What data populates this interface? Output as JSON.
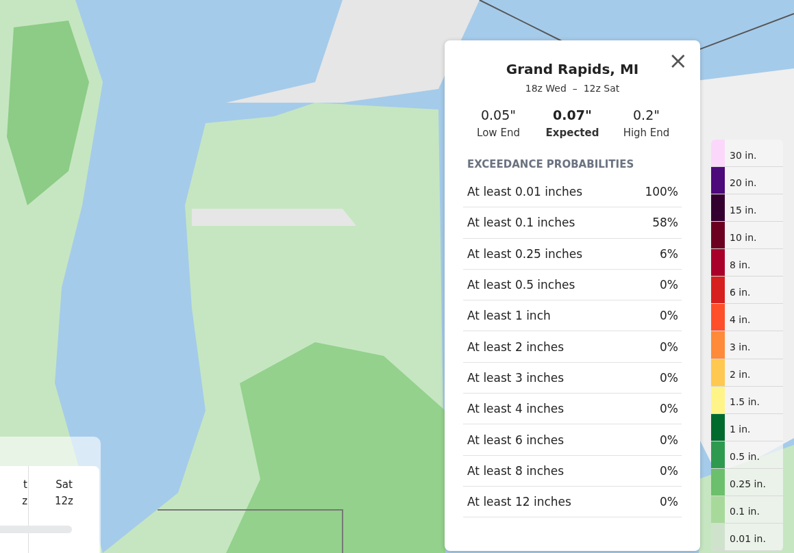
{
  "time_panel": {
    "columns": [
      {
        "day": "t",
        "hour": "z"
      },
      {
        "day": "Sat",
        "hour": "12z"
      }
    ]
  },
  "popup": {
    "title": "Grand Rapids, MI",
    "period": "18z Wed  –  12z Sat",
    "close": "×",
    "stats": [
      {
        "value": "0.05\"",
        "label": "Low End",
        "emphasis": false
      },
      {
        "value": "0.07\"",
        "label": "Expected",
        "emphasis": true
      },
      {
        "value": "0.2\"",
        "label": "High End",
        "emphasis": false
      }
    ],
    "section_title": "EXCEEDANCE PROBABILITIES",
    "rows": [
      {
        "label": "At least 0.01 inches",
        "value": "100%"
      },
      {
        "label": "At least 0.1 inches",
        "value": "58%"
      },
      {
        "label": "At least 0.25 inches",
        "value": "6%"
      },
      {
        "label": "At least 0.5 inches",
        "value": "0%"
      },
      {
        "label": "At least 1 inch",
        "value": "0%"
      },
      {
        "label": "At least 2 inches",
        "value": "0%"
      },
      {
        "label": "At least 3 inches",
        "value": "0%"
      },
      {
        "label": "At least 4 inches",
        "value": "0%"
      },
      {
        "label": "At least 6 inches",
        "value": "0%"
      },
      {
        "label": "At least 8 inches",
        "value": "0%"
      },
      {
        "label": "At least 12 inches",
        "value": "0%"
      }
    ]
  },
  "legend": [
    {
      "label": "30 in.",
      "color": "#fcd7fc"
    },
    {
      "label": "20 in.",
      "color": "#4d0a7a"
    },
    {
      "label": "15 in.",
      "color": "#33002f"
    },
    {
      "label": "10 in.",
      "color": "#6b0020"
    },
    {
      "label": "8 in.",
      "color": "#a8002a"
    },
    {
      "label": "6 in.",
      "color": "#d81f1f"
    },
    {
      "label": "4 in.",
      "color": "#ff4f2a"
    },
    {
      "label": "3 in.",
      "color": "#ff8a3a"
    },
    {
      "label": "2 in.",
      "color": "#ffc850"
    },
    {
      "label": "1.5 in.",
      "color": "#fff488"
    },
    {
      "label": "1 in.",
      "color": "#006b2d"
    },
    {
      "label": "0.5 in.",
      "color": "#2e9a50"
    },
    {
      "label": "0.25 in.",
      "color": "#6cbf6c"
    },
    {
      "label": "0.1 in.",
      "color": "#a7d99b"
    },
    {
      "label": "0.01 in.",
      "color": "#cfe3cc"
    }
  ]
}
